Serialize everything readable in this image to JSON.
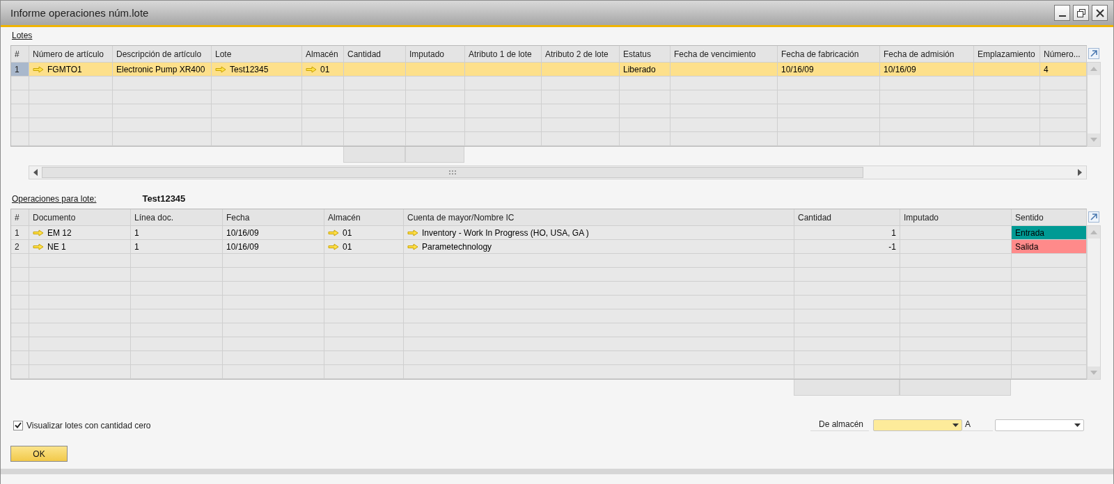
{
  "window": {
    "title": "Informe operaciones núm.lote"
  },
  "lotes": {
    "label": "Lotes",
    "columns": [
      {
        "label": "#",
        "kind": "index"
      },
      {
        "label": "Número de artículo",
        "kind": "link"
      },
      {
        "label": "Descripción de artículo",
        "kind": "text"
      },
      {
        "label": "Lote",
        "kind": "link"
      },
      {
        "label": "Almacén",
        "kind": "link"
      },
      {
        "label": "Cantidad",
        "kind": "number"
      },
      {
        "label": "Imputado",
        "kind": "number"
      },
      {
        "label": "Atributo 1 de lote",
        "kind": "text"
      },
      {
        "label": "Atributo 2 de lote",
        "kind": "text"
      },
      {
        "label": "Estatus",
        "kind": "text"
      },
      {
        "label": "Fecha de vencimiento",
        "kind": "text"
      },
      {
        "label": "Fecha de fabricación",
        "kind": "text"
      },
      {
        "label": "Fecha de admisión",
        "kind": "text"
      },
      {
        "label": "Emplazamiento",
        "kind": "text"
      },
      {
        "label": "Número...",
        "kind": "text"
      }
    ],
    "rows": [
      {
        "selected": true,
        "cells": [
          "1",
          "FGMTO1",
          "Electronic Pump XR400",
          "Test12345",
          "01",
          null,
          null,
          null,
          null,
          "Liberado",
          null,
          "10/16/09",
          "10/16/09",
          null,
          "4"
        ]
      }
    ]
  },
  "operaciones": {
    "label": "Operaciones para lote:",
    "lote": "Test12345",
    "columns": [
      {
        "label": "#",
        "kind": "index"
      },
      {
        "label": "Documento",
        "kind": "link"
      },
      {
        "label": "Línea doc.",
        "kind": "text"
      },
      {
        "label": "Fecha",
        "kind": "text"
      },
      {
        "label": "Almacén",
        "kind": "link"
      },
      {
        "label": "Cuenta de mayor/Nombre IC",
        "kind": "link"
      },
      {
        "label": "Cantidad",
        "kind": "number"
      },
      {
        "label": "Imputado",
        "kind": "number"
      },
      {
        "label": "Sentido",
        "kind": "status"
      }
    ],
    "rows": [
      {
        "selected": false,
        "color": "#009a94",
        "cells": [
          "1",
          "EM 12",
          "1",
          "10/16/09",
          "01",
          "Inventory - Work In Progress (HO, USA, GA )",
          "1",
          null,
          "Entrada"
        ]
      },
      {
        "selected": false,
        "color": "#ff8a8a",
        "cells": [
          "2",
          "NE 1",
          "1",
          "10/16/09",
          "01",
          "Parametechnology",
          "-1",
          null,
          "Salida"
        ]
      }
    ]
  },
  "show_zero": {
    "label": "Visualizar lotes con cantidad cero",
    "checked": true
  },
  "from_warehouse": {
    "label": "De almacén",
    "focused": true
  },
  "to_warehouse": {
    "label": "A",
    "focused": false
  },
  "ok_button": "OK"
}
